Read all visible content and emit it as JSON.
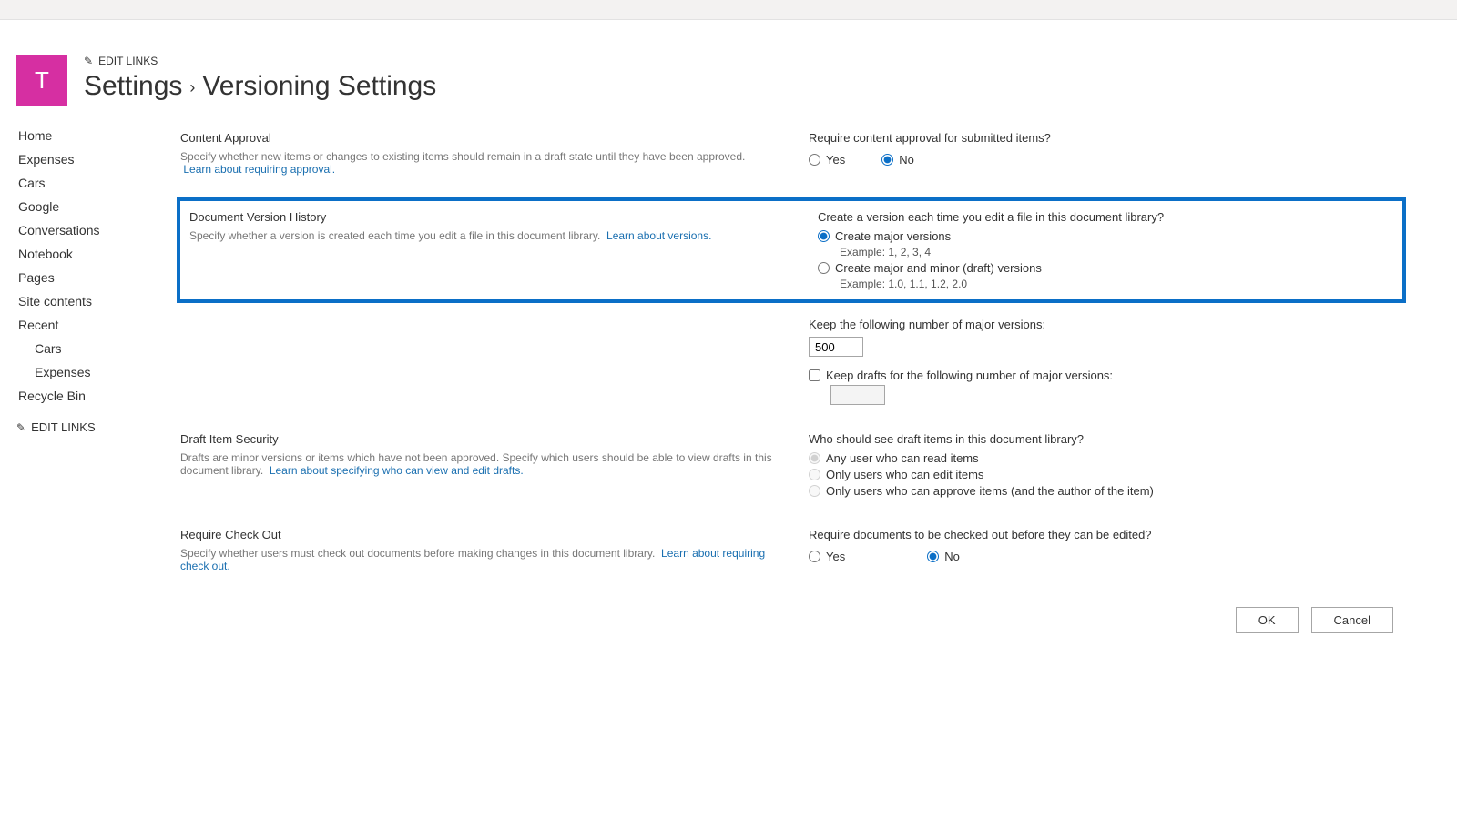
{
  "tile_letter": "T",
  "edit_links_label": "EDIT LINKS",
  "breadcrumb": {
    "root": "Settings",
    "current": "Versioning Settings"
  },
  "nav": {
    "items": [
      "Home",
      "Expenses",
      "Cars",
      "Google",
      "Conversations",
      "Notebook",
      "Pages",
      "Site contents"
    ],
    "recent_label": "Recent",
    "recent_items": [
      "Cars",
      "Expenses"
    ],
    "recycle": "Recycle Bin",
    "edit_links": "EDIT LINKS"
  },
  "sections": {
    "content_approval": {
      "title": "Content Approval",
      "desc": "Specify whether new items or changes to existing items should remain in a draft state until they have been approved.",
      "link": "Learn about requiring approval.",
      "question": "Require content approval for submitted items?",
      "yes": "Yes",
      "no": "No",
      "selected": "no"
    },
    "version_history": {
      "title": "Document Version History",
      "desc": "Specify whether a version is created each time you edit a file in this document library.",
      "link": "Learn about versions.",
      "question": "Create a version each time you edit a file in this document library?",
      "opt_major": "Create major versions",
      "opt_major_example": "Example: 1, 2, 3, 4",
      "opt_minor": "Create major and minor (draft) versions",
      "opt_minor_example": "Example: 1.0, 1.1, 1.2, 2.0",
      "selected": "major",
      "keep_major_label": "Keep the following number of major versions:",
      "keep_major_value": "500",
      "keep_drafts_label": "Keep drafts for the following number of major versions:",
      "keep_drafts_checked": false,
      "keep_drafts_value": ""
    },
    "draft_security": {
      "title": "Draft Item Security",
      "desc": "Drafts are minor versions or items which have not been approved. Specify which users should be able to view drafts in this document library.",
      "link": "Learn about specifying who can view and edit drafts.",
      "question": "Who should see draft items in this document library?",
      "opt_any": "Any user who can read items",
      "opt_edit": "Only users who can edit items",
      "opt_approve": "Only users who can approve items (and the author of the item)",
      "selected": "any",
      "disabled": true
    },
    "checkout": {
      "title": "Require Check Out",
      "desc": "Specify whether users must check out documents before making changes in this document library.",
      "link": "Learn about requiring check out.",
      "question": "Require documents to be checked out before they can be edited?",
      "yes": "Yes",
      "no": "No",
      "selected": "no"
    }
  },
  "buttons": {
    "ok": "OK",
    "cancel": "Cancel"
  }
}
